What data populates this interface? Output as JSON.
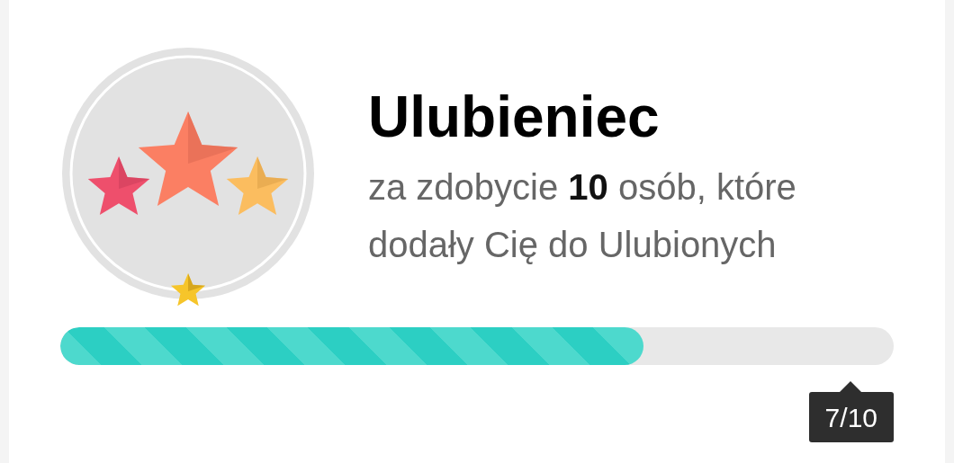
{
  "achievement": {
    "title": "Ulubieniec",
    "description": "za zdobycie **10** osób, które dodały Cię do Ulubionych"
  },
  "progress": {
    "level": 0.7,
    "reading": "7/10"
  }
}
